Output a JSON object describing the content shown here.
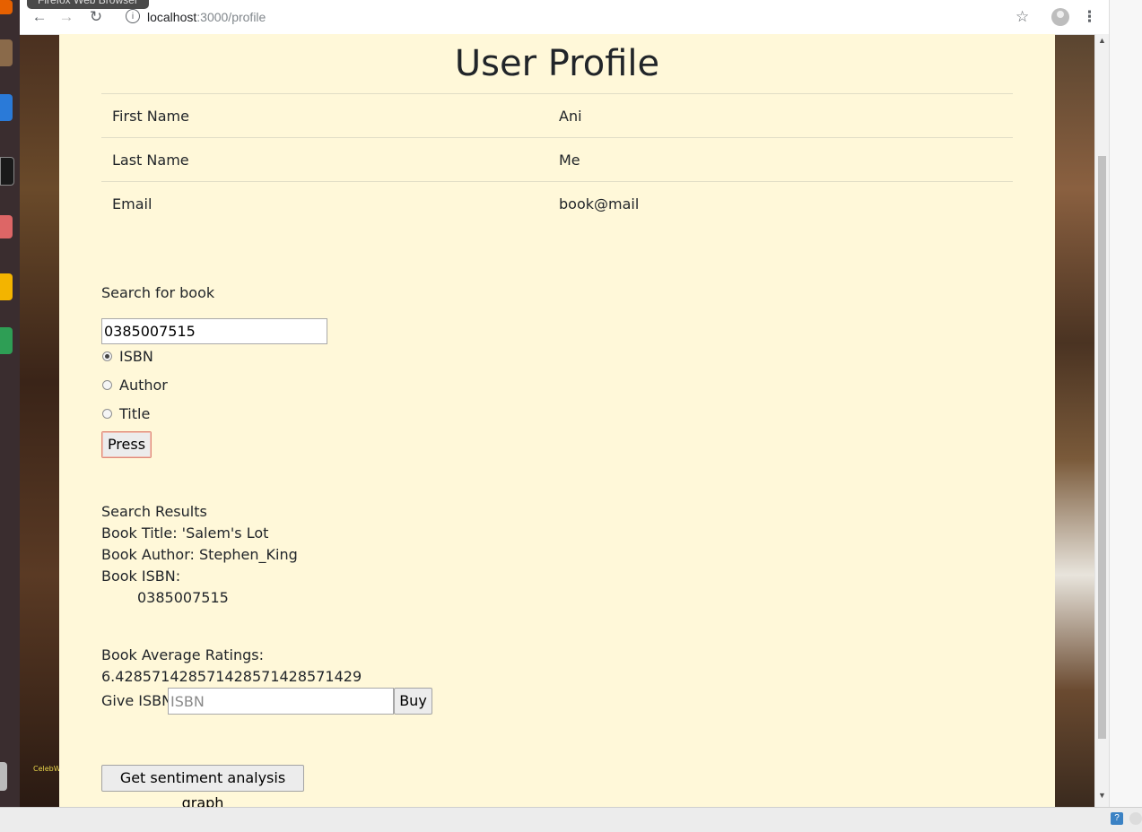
{
  "browser": {
    "tooltip": "Firefox Web Browser",
    "url_host": "localhost",
    "url_path": ":3000/profile",
    "icons": [
      "back-icon",
      "forward-icon",
      "reload-icon",
      "info-icon",
      "star-icon",
      "account-icon",
      "menu-icon"
    ]
  },
  "desktop": {
    "label": "CelebWa"
  },
  "page": {
    "title": "User Profile",
    "profile": [
      {
        "label": "First Name",
        "value": "Ani"
      },
      {
        "label": "Last Name",
        "value": "Me"
      },
      {
        "label": "Email",
        "value": "book@mail"
      }
    ],
    "search": {
      "heading": "Search for book",
      "query": "0385007515",
      "options": [
        {
          "label": "ISBN",
          "checked": true
        },
        {
          "label": "Author",
          "checked": false
        },
        {
          "label": "Title",
          "checked": false
        }
      ],
      "button": "Press"
    },
    "results": {
      "heading": "Search Results",
      "title_line": "Book Title: 'Salem's Lot",
      "author_line": "Book Author: Stephen_King",
      "isbn_label": "Book ISBN:",
      "isbn_value": "0385007515",
      "ratings_label": "Book Average Ratings:",
      "ratings_value": "6.428571428571428571428571429"
    },
    "buy": {
      "label": "Give ISBN:",
      "placeholder": "ISBN",
      "button": "Buy"
    },
    "graph_button": "Get sentiment analysis graph"
  },
  "colors": {
    "page_bg": "#fff8d9",
    "launcher_bg": "#3a2d2f"
  }
}
